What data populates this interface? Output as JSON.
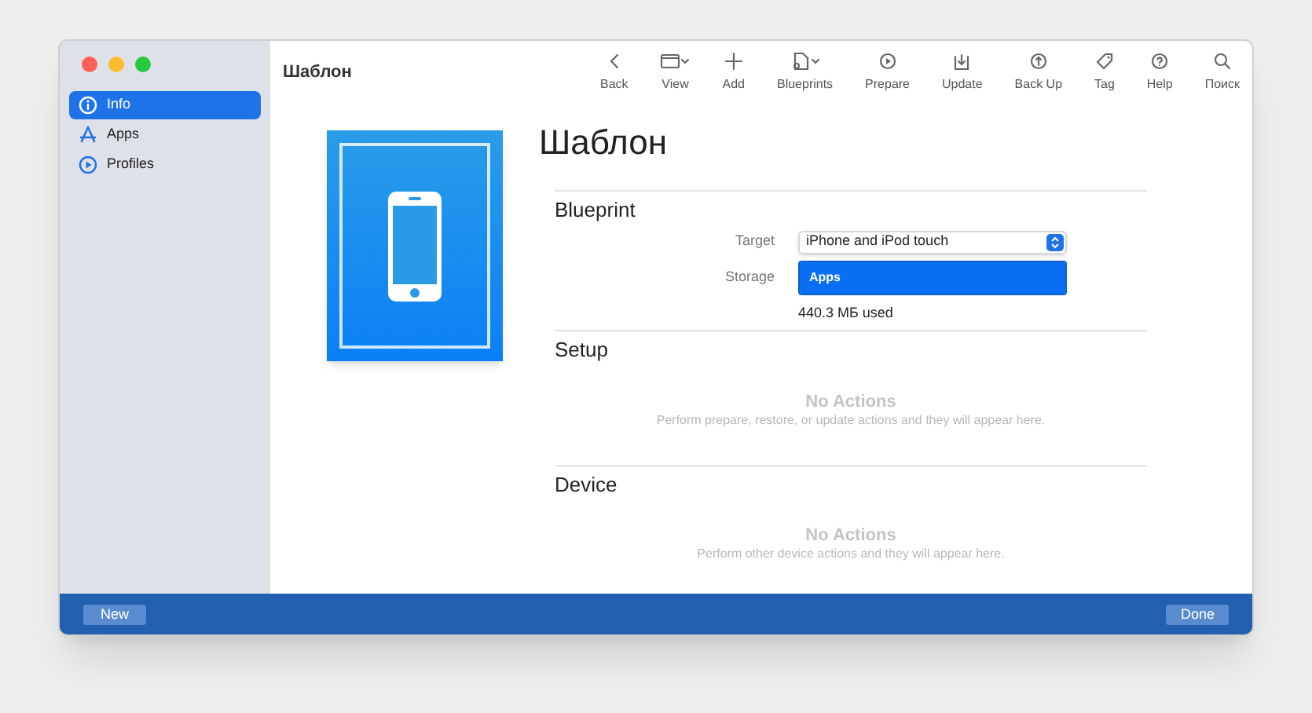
{
  "window": {
    "title": "Шаблон"
  },
  "sidebar": {
    "items": [
      {
        "label": "Info",
        "kind": "info",
        "selected": true
      },
      {
        "label": "Apps",
        "kind": "apps",
        "selected": false
      },
      {
        "label": "Profiles",
        "kind": "profiles",
        "selected": false
      }
    ]
  },
  "toolbar": [
    {
      "label": "Back",
      "kind": "back"
    },
    {
      "label": "View",
      "kind": "view"
    },
    {
      "label": "Add",
      "kind": "add"
    },
    {
      "label": "Blueprints",
      "kind": "blueprints"
    },
    {
      "label": "Prepare",
      "kind": "prepare"
    },
    {
      "label": "Update",
      "kind": "update"
    },
    {
      "label": "Back Up",
      "kind": "backup"
    },
    {
      "label": "Tag",
      "kind": "tag"
    },
    {
      "label": "Help",
      "kind": "help"
    },
    {
      "label": "Поиск",
      "kind": "search"
    }
  ],
  "heading": "Шаблон",
  "sections": [
    {
      "title": "Blueprint",
      "kind": "form",
      "fields": [
        {
          "label": "Target",
          "kind": "popup",
          "value": "iPhone and iPod touch"
        },
        {
          "label": "Storage",
          "kind": "bar",
          "value": "Apps",
          "level": 1
        }
      ],
      "note": "440.3 МБ used"
    },
    {
      "title": "Setup",
      "kind": "empty",
      "empty_title": "No Actions",
      "empty_text": "Perform prepare, restore, or update actions and they will appear here."
    },
    {
      "title": "Device",
      "kind": "empty",
      "empty_title": "No Actions",
      "empty_text": "Perform other device actions and they will appear here."
    }
  ],
  "footer": {
    "left_button": "New",
    "right_button": "Done"
  }
}
